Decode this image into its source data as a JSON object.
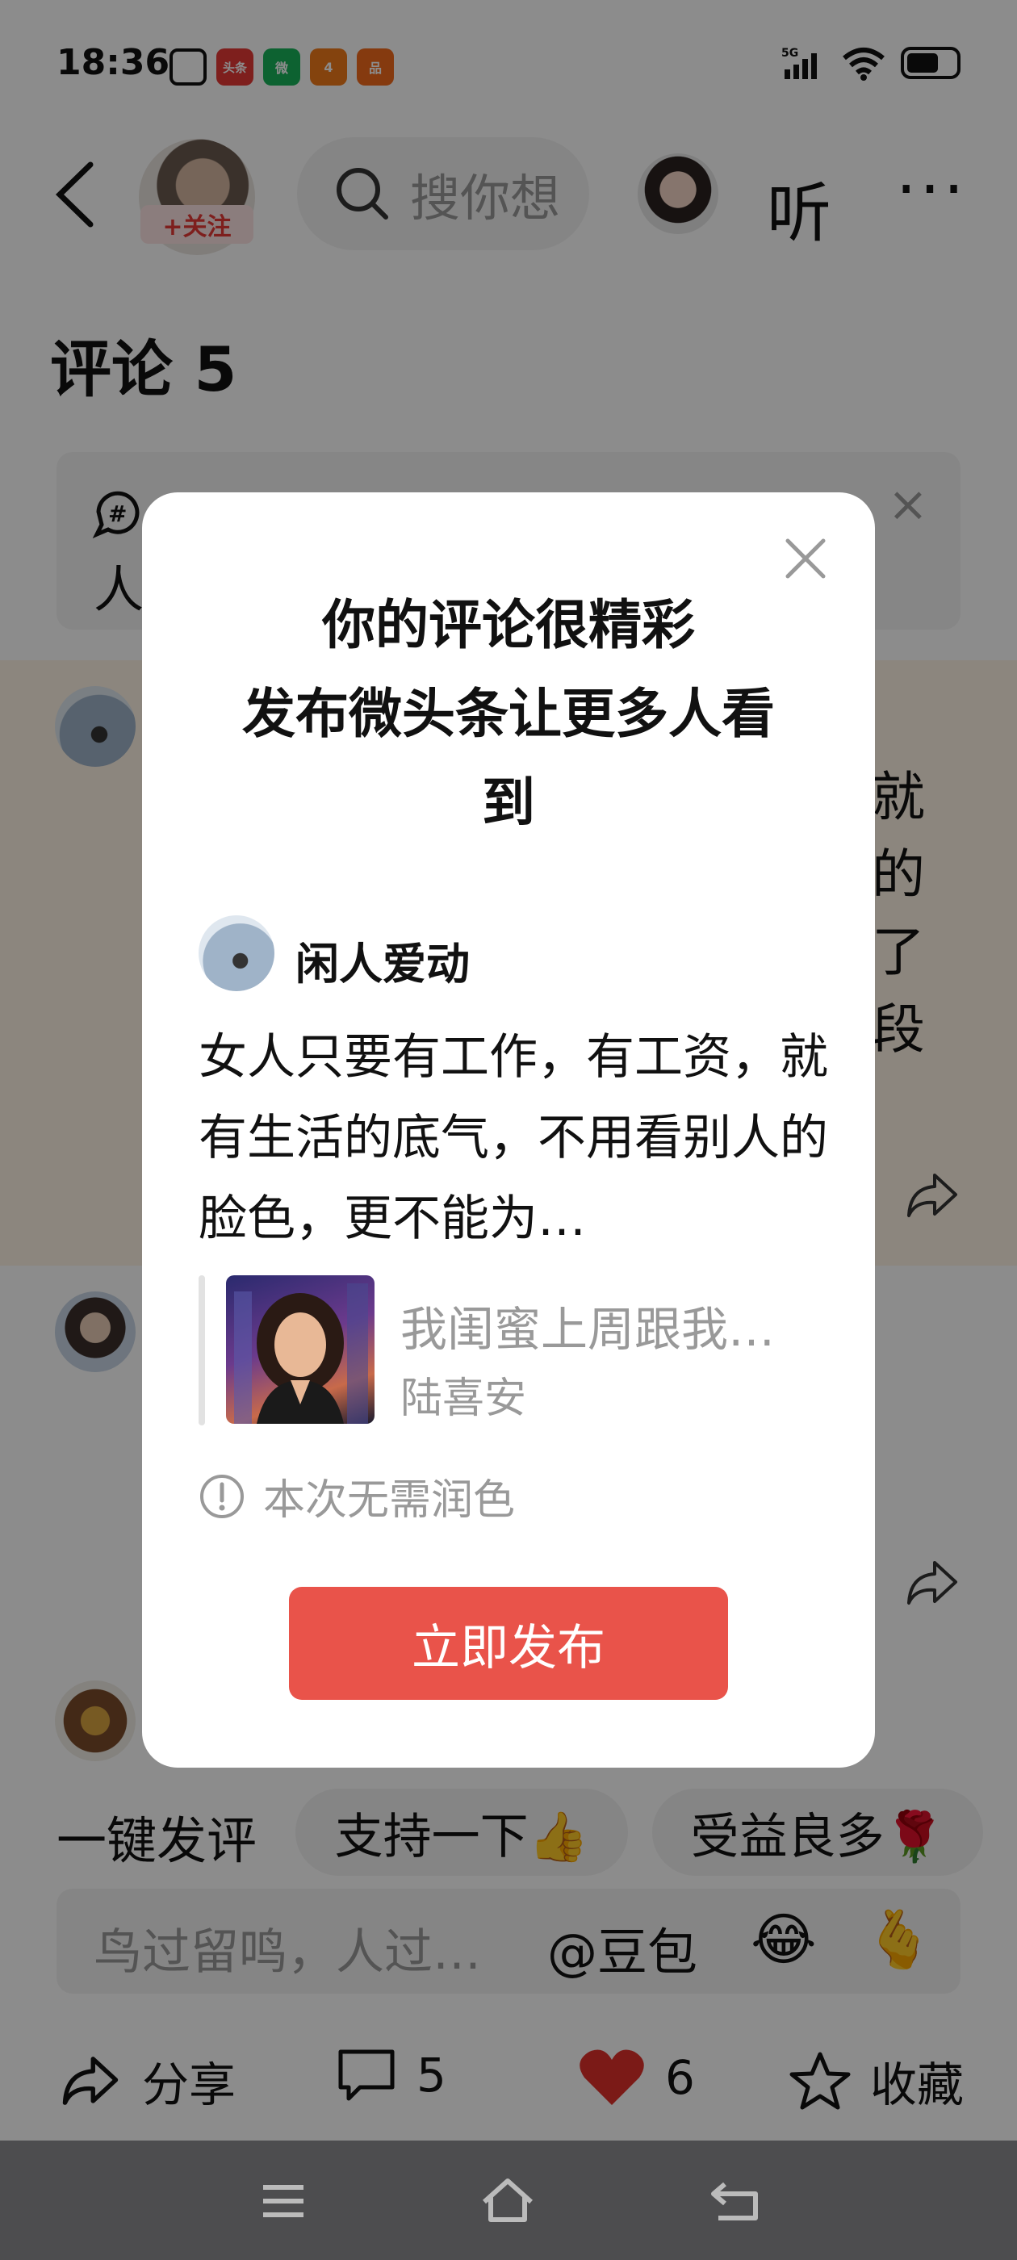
{
  "status_bar": {
    "time": "18:36",
    "apps": [
      "头条",
      "微",
      "4",
      "品"
    ],
    "network": "5G"
  },
  "top_bar": {
    "follow_label": "+关注",
    "search_placeholder": "搜你想",
    "listen_label": "听",
    "more_label": "···"
  },
  "comments": {
    "title": "评论 5",
    "topic_text": "人",
    "side_chars": [
      "就",
      "的",
      "了",
      "段"
    ]
  },
  "quick_reply": {
    "label": "一键发评",
    "chips": [
      "支持一下👍",
      "受益良多🌹"
    ]
  },
  "input": {
    "placeholder": "鸟过留鸣，人过…",
    "at_label": "@豆包",
    "emoji1": "😂",
    "emoji2": "🫰"
  },
  "actions": {
    "share_label": "分享",
    "comment_count": "5",
    "like_count": "6",
    "favorite_label": "收藏"
  },
  "dialog": {
    "title_line1": "你的评论很精彩",
    "title_line2": "发布微头条让更多人看",
    "title_line3": "到",
    "user_name": "闲人爱动",
    "body": "女人只要有工作，有工资，就有生活的底气，不用看别人的脸色，更不能为…",
    "quote_title": "我闺蜜上周跟我…",
    "quote_author": "陆喜安",
    "note": "本次无需润色",
    "publish_label": "立即发布"
  },
  "colors": {
    "accent": "#e9534a",
    "follow": "#e53935",
    "highlight_bg": "#fff4e6"
  }
}
